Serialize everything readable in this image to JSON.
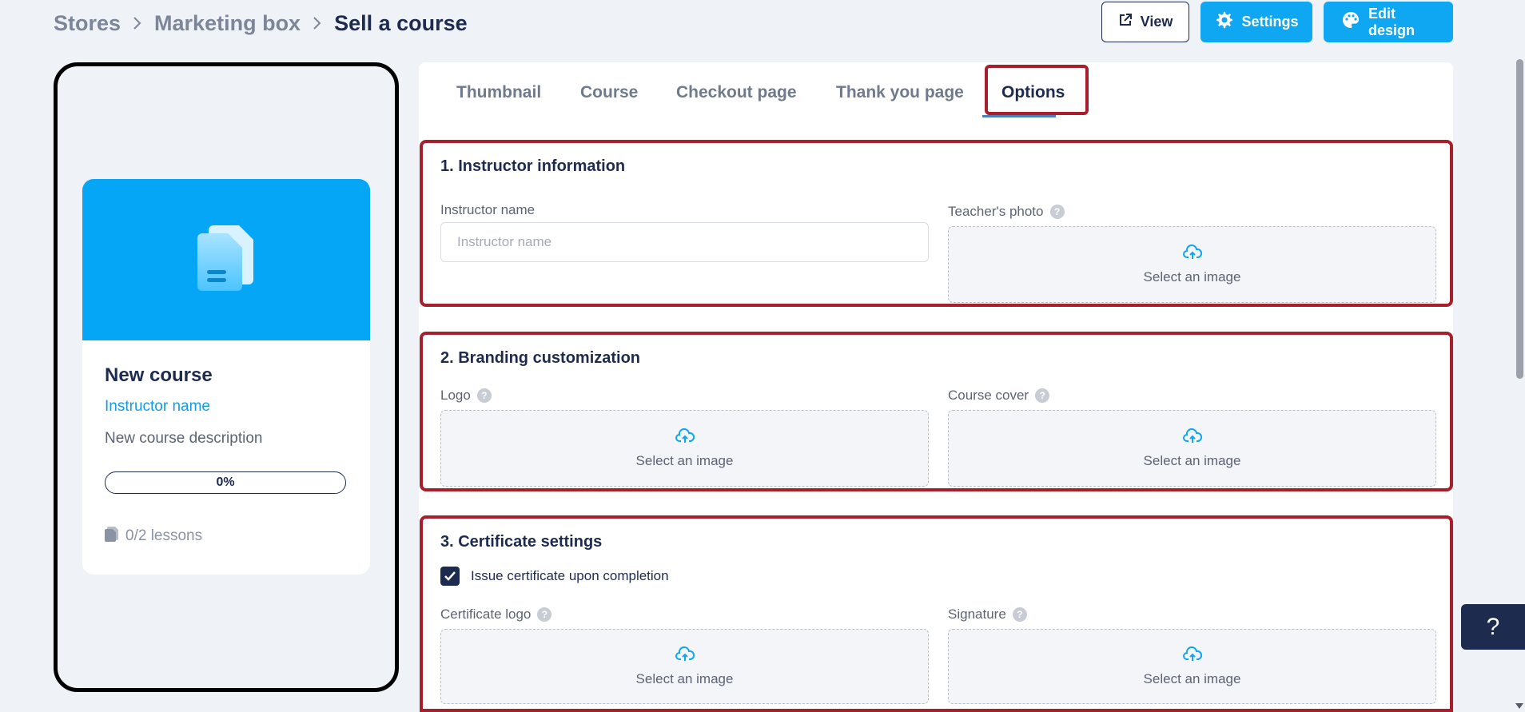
{
  "breadcrumb": {
    "items": [
      "Stores",
      "Marketing box"
    ],
    "current": "Sell a course"
  },
  "actions": {
    "view_label": "View",
    "settings_label": "Settings",
    "edit_design_label": "Edit design"
  },
  "preview": {
    "title": "New course",
    "instructor": "Instructor name",
    "description": "New course description",
    "progress": "0%",
    "progress_value": 0,
    "lessons": "0/2 lessons"
  },
  "tabs": [
    "Thumbnail",
    "Course",
    "Checkout page",
    "Thank you page",
    "Options"
  ],
  "active_tab": "Options",
  "sections": {
    "instructor": {
      "title": "1. Instructor information",
      "name_label": "Instructor name",
      "name_placeholder": "Instructor name",
      "name_value": "",
      "photo_label": "Teacher's photo",
      "photo_upload": "Select an image"
    },
    "branding": {
      "title": "2. Branding customization",
      "logo_label": "Logo",
      "logo_upload": "Select an image",
      "cover_label": "Course cover",
      "cover_upload": "Select an image"
    },
    "certificate": {
      "title": "3. Certificate settings",
      "issue_label": "Issue certificate upon completion",
      "issue_checked": true,
      "logo_label": "Certificate logo",
      "logo_upload": "Select an image",
      "signature_label": "Signature",
      "signature_upload": "Select an image"
    }
  },
  "help": {
    "icon_glyph": "?",
    "fab_label": "?"
  },
  "colors": {
    "primary": "#0fa6f2",
    "navy": "#1d2b4f",
    "highlight": "#a61f2a",
    "background": "#eff2f7"
  }
}
